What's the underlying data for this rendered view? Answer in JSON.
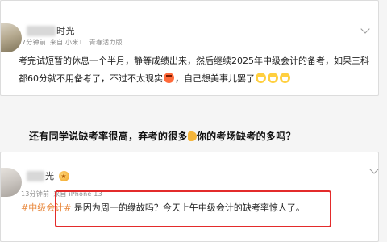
{
  "post_1": {
    "author_suffix": "时光",
    "meta": {
      "time": "7分钟前",
      "source": "来自 小米11 青春活力版"
    },
    "text": "考完试短暂的休息一个半月，静等成绩出来，然后继续2025年中级会计的备考，如果三科都60分就不用备考了，不过不太现实",
    "text_tail": "，自己想美事儿罢了"
  },
  "question": {
    "text_before": "还有同学说缺考率很高，弃考的很多",
    "text_after": "你的考场缺考的多吗？"
  },
  "post_2": {
    "author_suffix": "光",
    "meta": {
      "time": "13分钟前",
      "source": "来自 iPhone 13"
    },
    "hashtag": "#中级会计#",
    "text": " 是因为周一的缘故吗？今天上午中级会计的缺考率惊人了。"
  },
  "colors": {
    "hashtag": "#e8873b",
    "highlight": "#e32b2b"
  }
}
